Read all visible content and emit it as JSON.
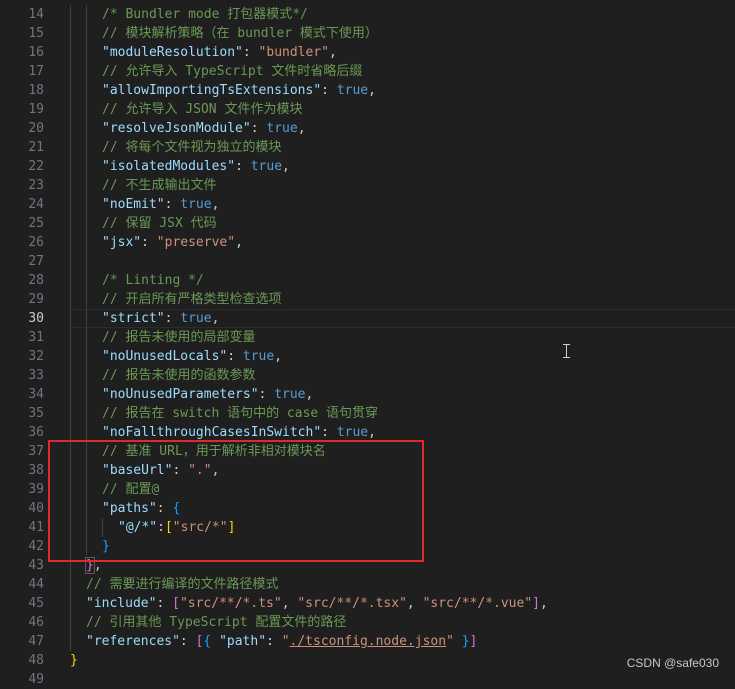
{
  "editor": {
    "current_line": "30",
    "lines": [
      {
        "n": "14",
        "indent": 2,
        "tokens": [
          {
            "t": "/* Bundler mode 打包器模式*/",
            "c": "comment"
          }
        ]
      },
      {
        "n": "15",
        "indent": 2,
        "tokens": [
          {
            "t": "// 模块解析策略（在 bundler 模式下使用）",
            "c": "comment"
          }
        ]
      },
      {
        "n": "16",
        "indent": 2,
        "tokens": [
          {
            "t": "\"moduleResolution\"",
            "c": "key"
          },
          {
            "t": ": ",
            "c": "punc"
          },
          {
            "t": "\"bundler\"",
            "c": "str"
          },
          {
            "t": ",",
            "c": "punc"
          }
        ]
      },
      {
        "n": "17",
        "indent": 2,
        "tokens": [
          {
            "t": "// 允许导入 TypeScript 文件时省略后缀",
            "c": "comment"
          }
        ]
      },
      {
        "n": "18",
        "indent": 2,
        "tokens": [
          {
            "t": "\"allowImportingTsExtensions\"",
            "c": "key"
          },
          {
            "t": ": ",
            "c": "punc"
          },
          {
            "t": "true",
            "c": "kw"
          },
          {
            "t": ",",
            "c": "punc"
          }
        ]
      },
      {
        "n": "19",
        "indent": 2,
        "tokens": [
          {
            "t": "// 允许导入 JSON 文件作为模块",
            "c": "comment"
          }
        ]
      },
      {
        "n": "20",
        "indent": 2,
        "tokens": [
          {
            "t": "\"resolveJsonModule\"",
            "c": "key"
          },
          {
            "t": ": ",
            "c": "punc"
          },
          {
            "t": "true",
            "c": "kw"
          },
          {
            "t": ",",
            "c": "punc"
          }
        ]
      },
      {
        "n": "21",
        "indent": 2,
        "tokens": [
          {
            "t": "// 将每个文件视为独立的模块",
            "c": "comment"
          }
        ]
      },
      {
        "n": "22",
        "indent": 2,
        "tokens": [
          {
            "t": "\"isolatedModules\"",
            "c": "key"
          },
          {
            "t": ": ",
            "c": "punc"
          },
          {
            "t": "true",
            "c": "kw"
          },
          {
            "t": ",",
            "c": "punc"
          }
        ]
      },
      {
        "n": "23",
        "indent": 2,
        "tokens": [
          {
            "t": "// 不生成输出文件",
            "c": "comment"
          }
        ]
      },
      {
        "n": "24",
        "indent": 2,
        "tokens": [
          {
            "t": "\"noEmit\"",
            "c": "key"
          },
          {
            "t": ": ",
            "c": "punc"
          },
          {
            "t": "true",
            "c": "kw"
          },
          {
            "t": ",",
            "c": "punc"
          }
        ]
      },
      {
        "n": "25",
        "indent": 2,
        "tokens": [
          {
            "t": "// 保留 JSX 代码",
            "c": "comment"
          }
        ]
      },
      {
        "n": "26",
        "indent": 2,
        "tokens": [
          {
            "t": "\"jsx\"",
            "c": "key"
          },
          {
            "t": ": ",
            "c": "punc"
          },
          {
            "t": "\"preserve\"",
            "c": "str"
          },
          {
            "t": ",",
            "c": "punc"
          }
        ]
      },
      {
        "n": "27",
        "indent": 2,
        "tokens": []
      },
      {
        "n": "28",
        "indent": 2,
        "tokens": [
          {
            "t": "/* Linting */",
            "c": "comment"
          }
        ]
      },
      {
        "n": "29",
        "indent": 2,
        "tokens": [
          {
            "t": "// 开启所有严格类型检查选项",
            "c": "comment"
          }
        ]
      },
      {
        "n": "30",
        "indent": 2,
        "tokens": [
          {
            "t": "\"strict\"",
            "c": "key"
          },
          {
            "t": ": ",
            "c": "punc"
          },
          {
            "t": "true",
            "c": "kw"
          },
          {
            "t": ",",
            "c": "punc"
          }
        ]
      },
      {
        "n": "31",
        "indent": 2,
        "tokens": [
          {
            "t": "// 报告未使用的局部变量",
            "c": "comment"
          }
        ]
      },
      {
        "n": "32",
        "indent": 2,
        "tokens": [
          {
            "t": "\"noUnusedLocals\"",
            "c": "key"
          },
          {
            "t": ": ",
            "c": "punc"
          },
          {
            "t": "true",
            "c": "kw"
          },
          {
            "t": ",",
            "c": "punc"
          }
        ]
      },
      {
        "n": "33",
        "indent": 2,
        "tokens": [
          {
            "t": "// 报告未使用的函数参数",
            "c": "comment"
          }
        ]
      },
      {
        "n": "34",
        "indent": 2,
        "tokens": [
          {
            "t": "\"noUnusedParameters\"",
            "c": "key"
          },
          {
            "t": ": ",
            "c": "punc"
          },
          {
            "t": "true",
            "c": "kw"
          },
          {
            "t": ",",
            "c": "punc"
          }
        ]
      },
      {
        "n": "35",
        "indent": 2,
        "tokens": [
          {
            "t": "// 报告在 switch 语句中的 case 语句贯穿",
            "c": "comment"
          }
        ]
      },
      {
        "n": "36",
        "indent": 2,
        "tokens": [
          {
            "t": "\"noFallthroughCasesInSwitch\"",
            "c": "key"
          },
          {
            "t": ": ",
            "c": "punc"
          },
          {
            "t": "true",
            "c": "kw"
          },
          {
            "t": ",",
            "c": "punc"
          }
        ]
      },
      {
        "n": "37",
        "indent": 2,
        "tokens": [
          {
            "t": "// 基准 URL，用于解析非相对模块名",
            "c": "comment"
          }
        ]
      },
      {
        "n": "38",
        "indent": 2,
        "tokens": [
          {
            "t": "\"baseUrl\"",
            "c": "key"
          },
          {
            "t": ": ",
            "c": "punc"
          },
          {
            "t": "\".\"",
            "c": "str"
          },
          {
            "t": ",",
            "c": "punc"
          }
        ]
      },
      {
        "n": "39",
        "indent": 2,
        "tokens": [
          {
            "t": "// 配置@",
            "c": "comment"
          }
        ]
      },
      {
        "n": "40",
        "indent": 2,
        "tokens": [
          {
            "t": "\"paths\"",
            "c": "key"
          },
          {
            "t": ": ",
            "c": "punc"
          },
          {
            "t": "{",
            "c": "b3"
          }
        ]
      },
      {
        "n": "41",
        "indent": 3,
        "tokens": [
          {
            "t": "\"@/*\"",
            "c": "key"
          },
          {
            "t": ":",
            "c": "punc"
          },
          {
            "t": "[",
            "c": "b1"
          },
          {
            "t": "\"src/*\"",
            "c": "str"
          },
          {
            "t": "]",
            "c": "b1"
          }
        ]
      },
      {
        "n": "42",
        "indent": 2,
        "tokens": [
          {
            "t": "}",
            "c": "b3"
          }
        ]
      },
      {
        "n": "43",
        "indent": 1,
        "tokens": [
          {
            "t": "}",
            "c": "b2"
          },
          {
            "t": ",",
            "c": "punc"
          }
        ]
      },
      {
        "n": "44",
        "indent": 1,
        "tokens": [
          {
            "t": "// 需要进行编译的文件路径模式",
            "c": "comment"
          }
        ]
      },
      {
        "n": "45",
        "indent": 1,
        "tokens": [
          {
            "t": "\"include\"",
            "c": "key"
          },
          {
            "t": ": ",
            "c": "punc"
          },
          {
            "t": "[",
            "c": "b2"
          },
          {
            "t": "\"src/**/*.ts\"",
            "c": "str"
          },
          {
            "t": ", ",
            "c": "punc"
          },
          {
            "t": "\"src/**/*.tsx\"",
            "c": "str"
          },
          {
            "t": ", ",
            "c": "punc"
          },
          {
            "t": "\"src/**/*.vue\"",
            "c": "str"
          },
          {
            "t": "]",
            "c": "b2"
          },
          {
            "t": ",",
            "c": "punc"
          }
        ]
      },
      {
        "n": "46",
        "indent": 1,
        "tokens": [
          {
            "t": "// 引用其他 TypeScript 配置文件的路径",
            "c": "comment"
          }
        ]
      },
      {
        "n": "47",
        "indent": 1,
        "tokens": [
          {
            "t": "\"references\"",
            "c": "key"
          },
          {
            "t": ": ",
            "c": "punc"
          },
          {
            "t": "[",
            "c": "b2"
          },
          {
            "t": "{",
            "c": "b3"
          },
          {
            "t": " ",
            "c": "punc"
          },
          {
            "t": "\"path\"",
            "c": "key"
          },
          {
            "t": ": ",
            "c": "punc"
          },
          {
            "t": "\"",
            "c": "str"
          },
          {
            "t": "./tsconfig.node.json",
            "c": "link"
          },
          {
            "t": "\"",
            "c": "str"
          },
          {
            "t": " ",
            "c": "punc"
          },
          {
            "t": "}",
            "c": "b3"
          },
          {
            "t": "]",
            "c": "b2"
          }
        ]
      },
      {
        "n": "48",
        "indent": 0,
        "tokens": [
          {
            "t": "}",
            "c": "b1"
          }
        ]
      },
      {
        "n": "49",
        "indent": 0,
        "tokens": []
      }
    ]
  },
  "watermark": "CSDN @safe030",
  "colors": {
    "background": "#1f1f1f",
    "comment": "#6a9955",
    "key": "#9cdcfe",
    "string": "#ce9178",
    "keyword": "#569cd6",
    "highlight_box": "#e0282e"
  }
}
